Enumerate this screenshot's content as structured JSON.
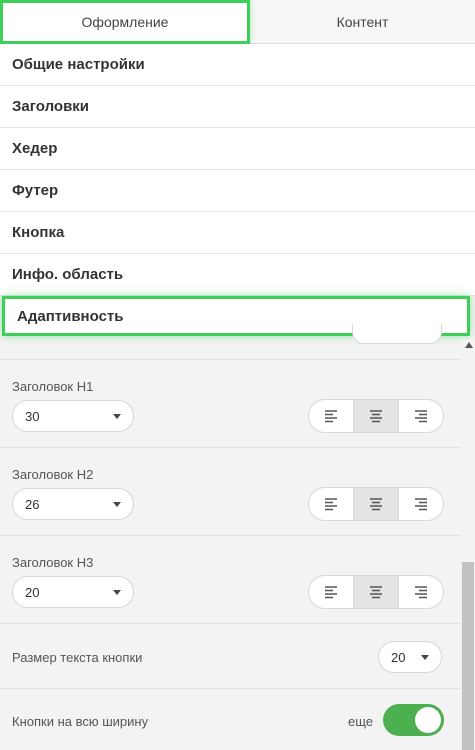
{
  "tabs": [
    {
      "label": "Оформление",
      "active": true
    },
    {
      "label": "Контент",
      "active": false
    }
  ],
  "menu": {
    "items": [
      "Общие настройки",
      "Заголовки",
      "Хедер",
      "Футер",
      "Кнопка",
      "Инфо. область",
      "Адаптивность"
    ],
    "active_index": 6
  },
  "settings": {
    "h1": {
      "label": "Заголовок H1",
      "value": "30",
      "alignment": "center"
    },
    "h2": {
      "label": "Заголовок H2",
      "value": "26",
      "alignment": "center"
    },
    "h3": {
      "label": "Заголовок H3",
      "value": "20",
      "alignment": "center"
    },
    "button_text_size": {
      "label": "Размер текста кнопки",
      "value": "20"
    },
    "full_width_buttons": {
      "label": "Кнопки на всю ширину",
      "value_label": "еще",
      "enabled": true
    }
  },
  "icons": {
    "align_left": "align-left-icon",
    "align_center": "align-center-icon",
    "align_right": "align-right-icon",
    "dropdown": "caret-down-icon"
  },
  "colors": {
    "highlight": "#3ecf5b",
    "toggle_on": "#4caf50",
    "active_segment": "#e4e4e4"
  }
}
